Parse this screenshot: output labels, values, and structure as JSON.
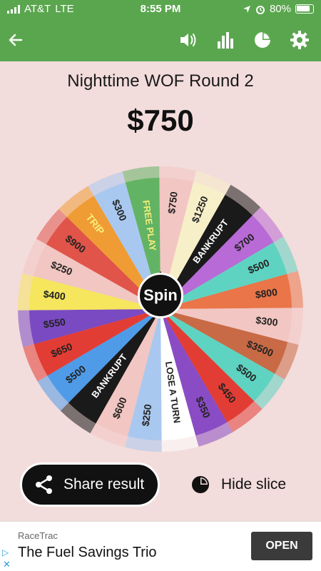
{
  "status_bar": {
    "carrier": "AT&T",
    "network": "LTE",
    "time": "8:55 PM",
    "battery": "80%",
    "icons": [
      "signal-icon",
      "location-icon",
      "alarm-icon",
      "battery-charging-icon"
    ]
  },
  "toolbar": {
    "icons": [
      "back-arrow-icon",
      "sound-icon",
      "stats-icon",
      "pie-chart-icon",
      "settings-icon"
    ]
  },
  "wheel": {
    "title": "Nighttime WOF Round 2",
    "result": "$750",
    "spin_label": "Spin",
    "slices": [
      {
        "label": "$750",
        "color": "#f2c6c2",
        "text": "#222"
      },
      {
        "label": "$1250",
        "color": "#f6efc8",
        "text": "#222"
      },
      {
        "label": "BANKRUPT",
        "color": "#1a1a1a",
        "text": "#ffffff"
      },
      {
        "label": "$700",
        "color": "#b86ad6",
        "text": "#222"
      },
      {
        "label": "$500",
        "color": "#5fd3c1",
        "text": "#222"
      },
      {
        "label": "$800",
        "color": "#e97548",
        "text": "#222"
      },
      {
        "label": "$300",
        "color": "#f2c6c2",
        "text": "#222"
      },
      {
        "label": "$3500",
        "color": "#c86a45",
        "text": "#222"
      },
      {
        "label": "$500",
        "color": "#5fd3c1",
        "text": "#222"
      },
      {
        "label": "$450",
        "color": "#e23d34",
        "text": "#222"
      },
      {
        "label": "$350",
        "color": "#8a4cc4",
        "text": "#222"
      },
      {
        "label": "LOSE A TURN",
        "color": "#ffffff",
        "text": "#222"
      },
      {
        "label": "$250",
        "color": "#a9c8ef",
        "text": "#222"
      },
      {
        "label": "$600",
        "color": "#f2c6c2",
        "text": "#222"
      },
      {
        "label": "BANKRUPT",
        "color": "#1a1a1a",
        "text": "#ffffff"
      },
      {
        "label": "$500",
        "color": "#4f9be8",
        "text": "#222"
      },
      {
        "label": "$650",
        "color": "#e23d34",
        "text": "#222"
      },
      {
        "label": "$550",
        "color": "#7a4ac2",
        "text": "#222"
      },
      {
        "label": "$400",
        "color": "#f5e65e",
        "text": "#222"
      },
      {
        "label": "$250",
        "color": "#f2c6c2",
        "text": "#222"
      },
      {
        "label": "$900",
        "color": "#e0544a",
        "text": "#222"
      },
      {
        "label": "TRIP",
        "color": "#ef9c34",
        "text": "#f6ef7a"
      },
      {
        "label": "$300",
        "color": "#a9c8ef",
        "text": "#222"
      },
      {
        "label": "FREE PLAY",
        "color": "#63b364",
        "text": "#f6ef7a"
      }
    ]
  },
  "actions": {
    "share_label": "Share result",
    "hide_label": "Hide slice"
  },
  "ad": {
    "brand": "RaceTrac",
    "headline": "The Fuel Savings Trio",
    "cta": "OPEN",
    "info_icon": "ad-info-icon",
    "close_icon": "ad-close-icon"
  }
}
